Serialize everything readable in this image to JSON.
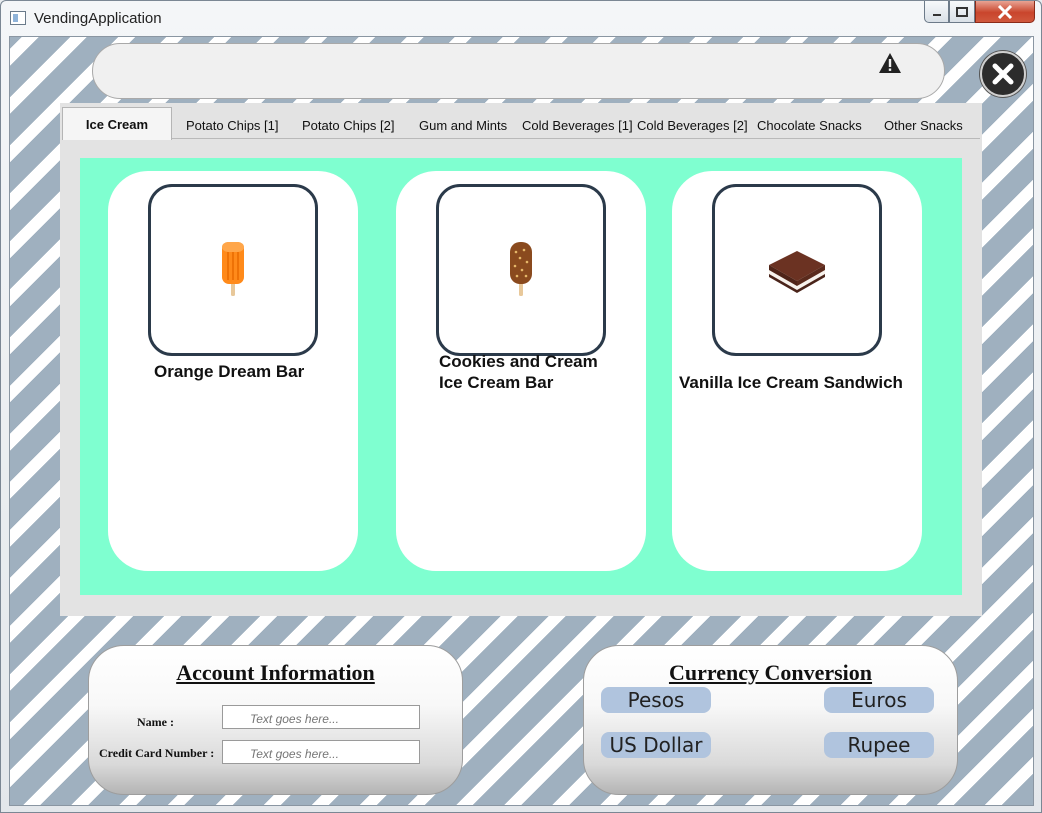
{
  "window": {
    "title": "VendingApplication",
    "buttons": [
      "minimize",
      "maximize",
      "close"
    ]
  },
  "alert_bar": {
    "icon": "warning-icon"
  },
  "tabs": [
    {
      "label": "Ice Cream",
      "active": true
    },
    {
      "label": "Potato Chips [1]"
    },
    {
      "label": "Potato Chips [2]"
    },
    {
      "label": "Gum and Mints"
    },
    {
      "label": "Cold Beverages [1]"
    },
    {
      "label": "Cold Beverages [2]"
    },
    {
      "label": "Chocolate Snacks"
    },
    {
      "label": "Other Snacks"
    }
  ],
  "products": [
    {
      "name": "Orange Dream Bar",
      "icon": "orange-popsicle-icon"
    },
    {
      "name": "Cookies and Cream Ice Cream Bar",
      "line1": "Cookies and Cream",
      "line2": "Ice Cream Bar",
      "icon": "chocolate-bar-icon"
    },
    {
      "name": "Vanilla Ice Cream Sandwich",
      "icon": "ice-cream-sandwich-icon"
    }
  ],
  "account": {
    "title": "Account Information",
    "name_label": "Name :",
    "name_placeholder": "Text goes here...",
    "card_label": "Credit Card Number :",
    "card_placeholder": "Text goes here..."
  },
  "currency": {
    "title": "Currency Conversion",
    "buttons": [
      "Pesos",
      "Euros",
      "US Dollar",
      "Rupee"
    ]
  },
  "colors": {
    "tab_content_bg": "#7fffd0",
    "currency_button": "#b0c4de",
    "stripe": "#9fb0bf"
  }
}
